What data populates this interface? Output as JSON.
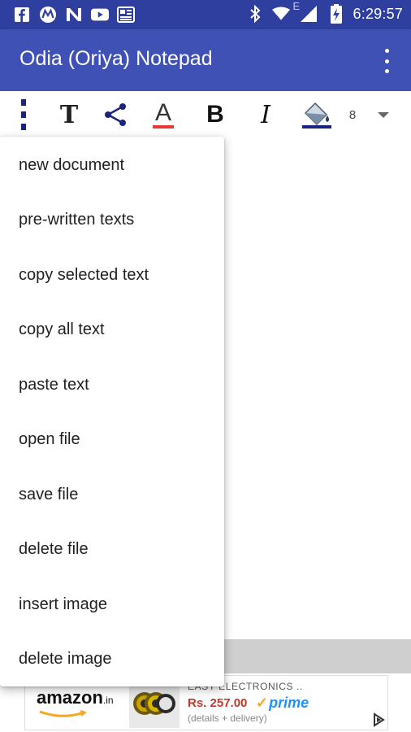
{
  "status_bar": {
    "time": "6:29:57",
    "network_type": "E",
    "notification_icons": [
      "facebook-icon",
      "motorola-icon",
      "news-icon",
      "youtube-icon",
      "newspaper-icon"
    ],
    "system_icons": [
      "bluetooth-icon",
      "wifi-icon",
      "signal-icon",
      "battery-charging-icon"
    ]
  },
  "app_bar": {
    "title": "Odia (Oriya) Notepad",
    "overflow_icon": "more-vert-icon"
  },
  "toolbar": {
    "items": [
      "more-vert-icon",
      "text-font-icon",
      "share-icon",
      "text-color-icon",
      "bold-icon",
      "italic-icon",
      "fill-color-icon"
    ],
    "font_size": "8",
    "font_letter": "T",
    "color_letter": "A",
    "bold_letter": "B",
    "italic_letter": "I"
  },
  "menu": {
    "items": [
      {
        "label": "new document"
      },
      {
        "label": "pre-written texts"
      },
      {
        "label": "copy selected text"
      },
      {
        "label": "copy all text"
      },
      {
        "label": "paste text"
      },
      {
        "label": "open file"
      },
      {
        "label": "save file"
      },
      {
        "label": "delete file"
      },
      {
        "label": "insert image"
      },
      {
        "label": "delete image"
      }
    ]
  },
  "ad": {
    "brand": "amazon",
    "brand_suffix": ".in",
    "title": "EASY ELECTRONICS ..",
    "price": "Rs. 257.00",
    "prime_label": "prime",
    "subtext": "(details + delivery)"
  },
  "colors": {
    "status_bar": "#2f3fa0",
    "app_bar": "#3f51b5",
    "accent_red": "#e53935",
    "price_red": "#c0392b",
    "prime_blue": "#1e90ff"
  }
}
